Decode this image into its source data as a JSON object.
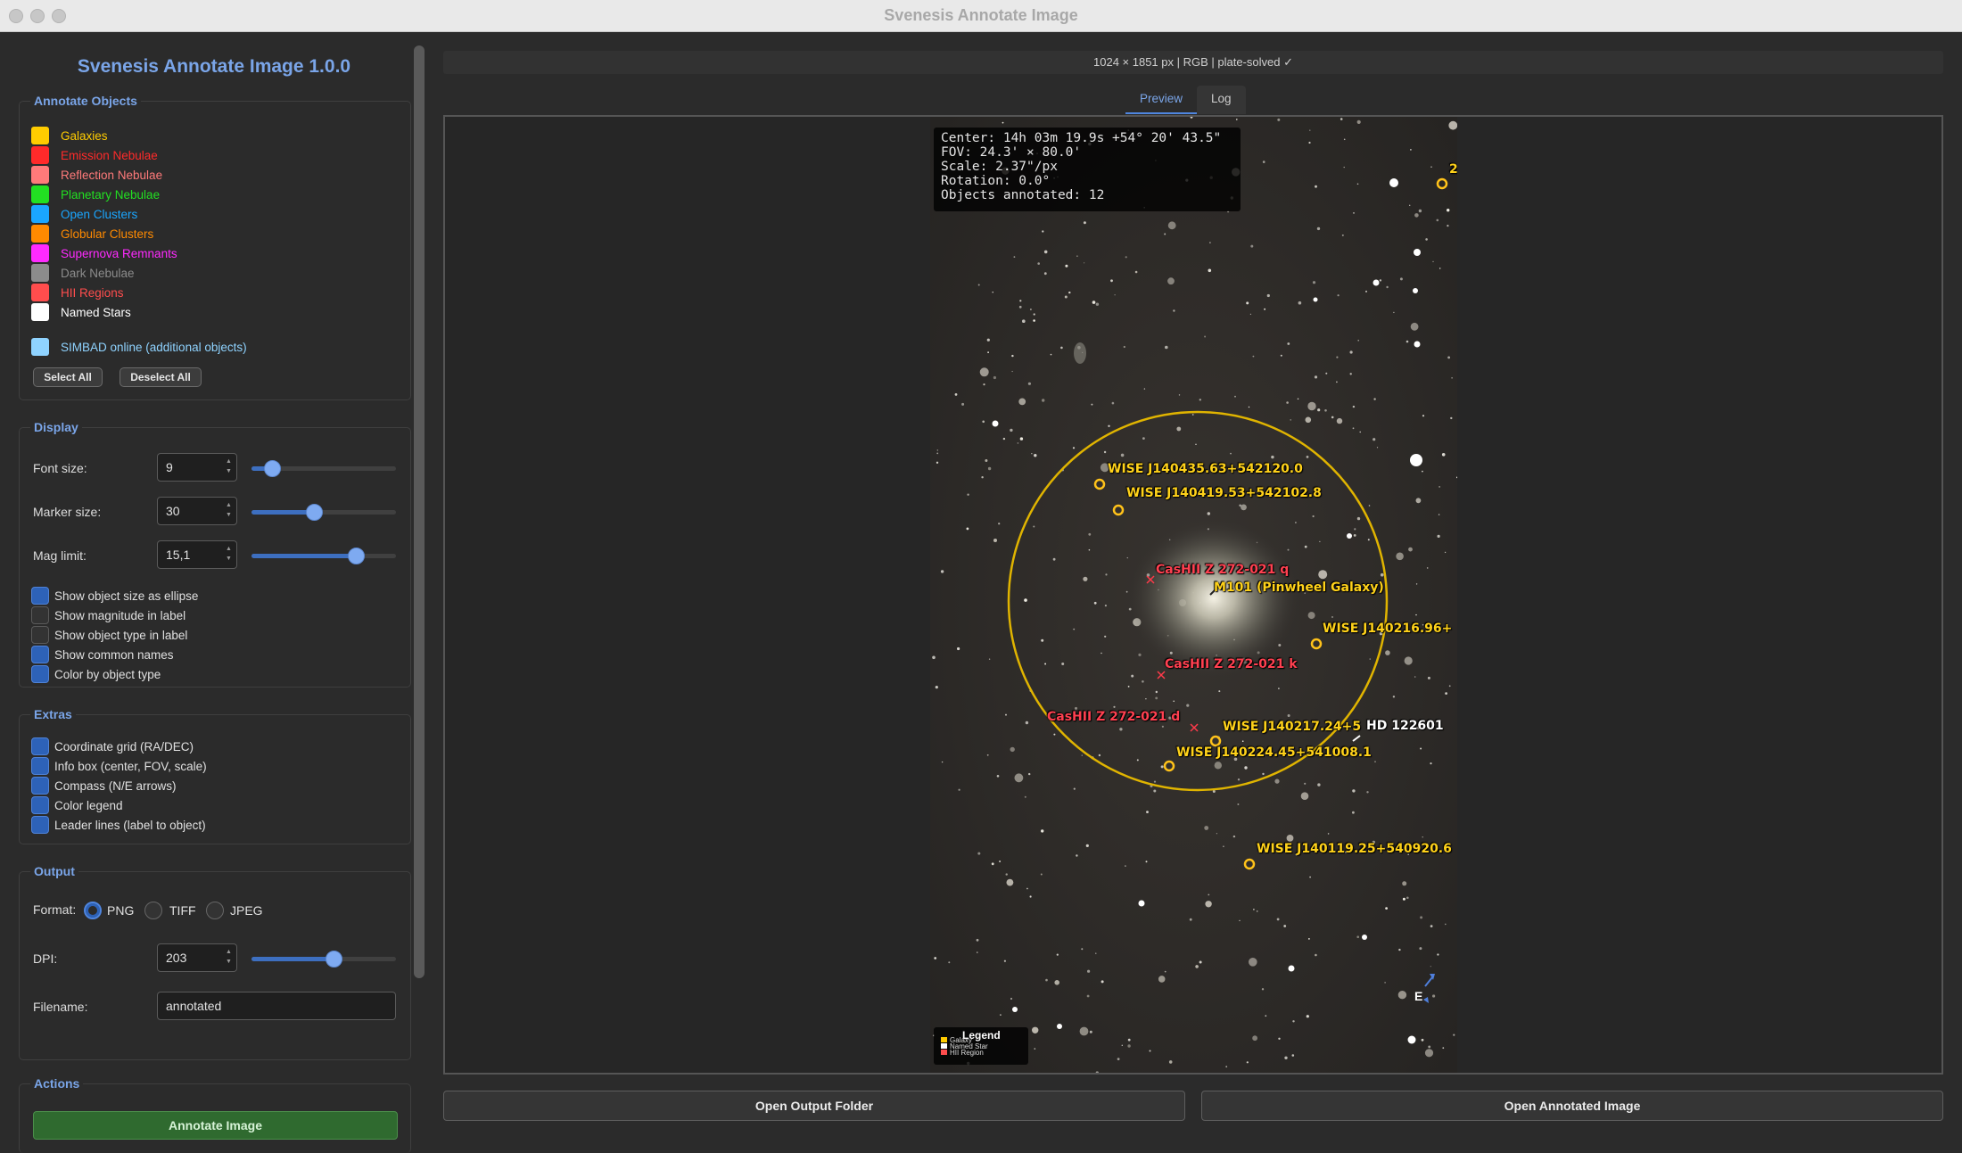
{
  "window": {
    "title": "Svenesis Annotate Image"
  },
  "app_heading": "Svenesis Annotate Image 1.0.0",
  "annotate_objects": {
    "title": "Annotate Objects",
    "items": [
      {
        "label": "Galaxies",
        "color": "#ffcc00"
      },
      {
        "label": "Emission Nebulae",
        "color": "#ff2a2a"
      },
      {
        "label": "Reflection Nebulae",
        "color": "#ff7a7a"
      },
      {
        "label": "Planetary Nebulae",
        "color": "#22e022"
      },
      {
        "label": "Open Clusters",
        "color": "#1aa6ff"
      },
      {
        "label": "Globular Clusters",
        "color": "#ff8a00"
      },
      {
        "label": "Supernova Remnants",
        "color": "#ff2aff"
      },
      {
        "label": "Dark Nebulae",
        "color": "#8c8c8c"
      },
      {
        "label": "HII Regions",
        "color": "#ff4d4d"
      },
      {
        "label": "Named Stars",
        "color": "#ffffff"
      }
    ],
    "simbad": {
      "label": "SIMBAD online (additional objects)",
      "color": "#8fd3ff"
    },
    "select_all": "Select All",
    "deselect_all": "Deselect All"
  },
  "display": {
    "title": "Display",
    "font_size": {
      "label": "Font size:",
      "value": "9",
      "slider_fraction": 0.14
    },
    "marker_size": {
      "label": "Marker size:",
      "value": "30",
      "slider_fraction": 0.43
    },
    "mag_limit": {
      "label": "Mag limit:",
      "value": "15,1",
      "slider_fraction": 0.72
    },
    "checks": [
      {
        "label": "Show object size as ellipse",
        "checked": true
      },
      {
        "label": "Show magnitude in label",
        "checked": false
      },
      {
        "label": "Show object type in label",
        "checked": false
      },
      {
        "label": "Show common names",
        "checked": true
      },
      {
        "label": "Color by object type",
        "checked": true
      }
    ]
  },
  "extras": {
    "title": "Extras",
    "checks": [
      {
        "label": "Coordinate grid (RA/DEC)",
        "checked": true
      },
      {
        "label": "Info box (center, FOV, scale)",
        "checked": true
      },
      {
        "label": "Compass (N/E arrows)",
        "checked": true
      },
      {
        "label": "Color legend",
        "checked": true
      },
      {
        "label": "Leader lines (label to object)",
        "checked": true
      }
    ]
  },
  "output": {
    "title": "Output",
    "format_label": "Format:",
    "formats": [
      {
        "label": "PNG",
        "selected": true
      },
      {
        "label": "TIFF",
        "selected": false
      },
      {
        "label": "JPEG",
        "selected": false
      }
    ],
    "dpi": {
      "label": "DPI:",
      "value": "203",
      "slider_fraction": 0.57
    },
    "filename": {
      "label": "Filename:",
      "value": "annotated"
    }
  },
  "actions": {
    "title": "Actions",
    "annotate_button": "Annotate Image"
  },
  "infobar": "1024 × 1851 px  |  RGB  |  plate-solved ✓",
  "tabs": [
    {
      "label": "Preview",
      "active": true
    },
    {
      "label": "Log",
      "active": false
    }
  ],
  "preview": {
    "info_box": [
      "Center: 14h 03m 19.9s  +54° 20' 43.5\"",
      "FOV: 24.3' × 80.0'",
      "Scale: 2.37\"/px",
      "Rotation: 0.0°",
      "Objects annotated: 12"
    ],
    "annotations": {
      "wise_1": "WISE J140435.63+542120.0",
      "wise_2": "WISE J140419.53+542102.8",
      "cashii_q": "CasHII Z 272-021 q",
      "m101": "M101 (Pinwheel Galaxy)",
      "wise_3": "WISE J140216.96+",
      "cashii_k": "CasHII Z 272-021 k",
      "cashii_d": "CasHII Z 272-021 d",
      "wise_4": "WISE J140217.24+5",
      "hd": "HD 122601",
      "wise_5": "WISE J140224.45+541008.1",
      "wise_6": "WISE J140119.25+540920.6",
      "top_right": "2"
    },
    "legend": {
      "title": "Legend",
      "items": [
        {
          "label": "Galaxy",
          "color": "#ffcc00"
        },
        {
          "label": "Named Star",
          "color": "#ffffff"
        },
        {
          "label": "HII Region",
          "color": "#ff4d4d"
        }
      ]
    },
    "compass_e": "E"
  },
  "buttons": {
    "open_folder": "Open Output Folder",
    "open_image": "Open Annotated Image"
  }
}
